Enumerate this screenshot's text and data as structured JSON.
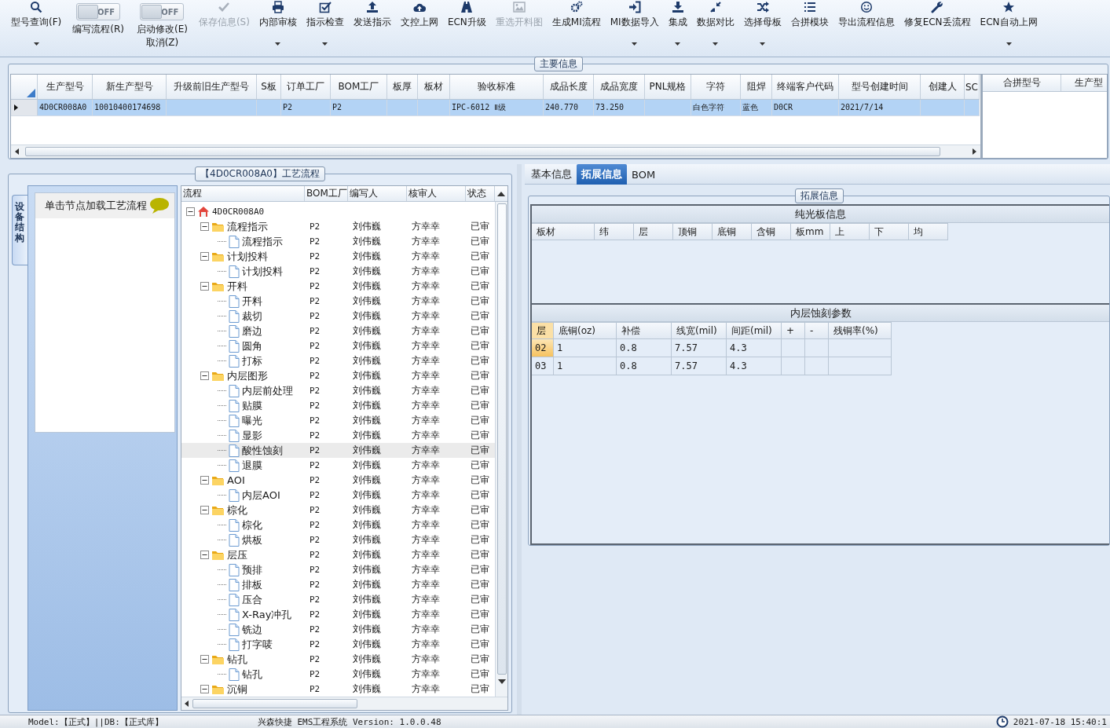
{
  "toolbar": [
    {
      "kind": "button",
      "label": "型号查询(F)",
      "disabled": false,
      "dropdown": true
    },
    {
      "kind": "toggle",
      "state": "OFF",
      "on": false,
      "lines": [
        "编写流程(R)"
      ]
    },
    {
      "kind": "toggle",
      "state": "OFF",
      "on": false,
      "lines": [
        "启动修改(E)",
        "取消(Z)"
      ]
    },
    {
      "kind": "button",
      "label": "保存信息(S)",
      "disabled": true,
      "dropdown": false
    },
    {
      "kind": "button",
      "label": "内部审核",
      "disabled": false,
      "dropdown": true
    },
    {
      "kind": "button",
      "label": "指示检查",
      "disabled": false,
      "dropdown": true
    },
    {
      "kind": "button",
      "label": "发送指示",
      "disabled": false,
      "dropdown": false
    },
    {
      "kind": "button",
      "label": "文控上网",
      "disabled": false,
      "dropdown": false
    },
    {
      "kind": "button",
      "label": "ECN升级",
      "disabled": false,
      "dropdown": false
    },
    {
      "kind": "button",
      "label": "重选开料图",
      "disabled": true,
      "dropdown": false
    },
    {
      "kind": "button",
      "label": "生成MI流程",
      "disabled": false,
      "dropdown": false
    },
    {
      "kind": "button",
      "label": "MI数据导入",
      "disabled": false,
      "dropdown": true
    },
    {
      "kind": "button",
      "label": "集成",
      "disabled": false,
      "dropdown": true
    },
    {
      "kind": "button",
      "label": "数据对比",
      "disabled": false,
      "dropdown": true
    },
    {
      "kind": "button",
      "label": "选择母板",
      "disabled": false,
      "dropdown": true
    },
    {
      "kind": "button",
      "label": "合拼模块",
      "disabled": false,
      "dropdown": false
    },
    {
      "kind": "button",
      "label": "导出流程信息",
      "disabled": false,
      "dropdown": false
    },
    {
      "kind": "button",
      "label": "修复ECN丢流程",
      "disabled": false,
      "dropdown": false
    },
    {
      "kind": "button",
      "label": "ECN自动上网",
      "disabled": false,
      "dropdown": true
    }
  ],
  "main_info": {
    "title": "主要信息",
    "columns": [
      "生产型号",
      "新生产型号",
      "升级前旧生产型号",
      "S板",
      "订单工厂",
      "BOM工厂",
      "板厚",
      "板材",
      "验收标准",
      "成品长度",
      "成品宽度",
      "PNL规格",
      "字符",
      "阻焊",
      "终端客户代码",
      "型号创建时间",
      "创建人",
      "SC"
    ],
    "rows": [
      {
        "selected": true,
        "cells": [
          "4D0CR008A0",
          "10010400174698",
          null,
          null,
          "P2",
          "P2",
          null,
          null,
          "IPC-6012 Ⅱ级",
          "240.770",
          "73.250",
          null,
          "白色字符",
          "蓝色",
          "D0CR",
          "2021/7/14",
          null,
          null
        ]
      }
    ],
    "side_table": {
      "columns": [
        "合拼型号",
        "生产型"
      ]
    }
  },
  "process_panel": {
    "title": "【4D0CR008A0】工艺流程",
    "side_tab": "设备结构",
    "hint": "单击节点加载工艺流程",
    "tree": {
      "columns": [
        "流程",
        "BOM工厂",
        "编写人",
        "核审人",
        "状态"
      ],
      "nodes": [
        {
          "kind": "root",
          "label": "4D0CR008A0",
          "expanded": true,
          "selected": false,
          "children": [
            {
              "kind": "folder",
              "label": "流程指示",
              "bom": "P2",
              "writer": "刘伟巍",
              "reviewer": "方幸幸",
              "status": "已审",
              "expanded": true,
              "selected": false,
              "children": [
                {
                  "kind": "step",
                  "label": "流程指示",
                  "bom": "P2",
                  "writer": "刘伟巍",
                  "reviewer": "方幸幸",
                  "status": "已审",
                  "selected": false
                }
              ]
            },
            {
              "kind": "folder",
              "label": "计划投料",
              "bom": "P2",
              "writer": "刘伟巍",
              "reviewer": "方幸幸",
              "status": "已审",
              "expanded": true,
              "selected": false,
              "children": [
                {
                  "kind": "step",
                  "label": "计划投料",
                  "bom": "P2",
                  "writer": "刘伟巍",
                  "reviewer": "方幸幸",
                  "status": "已审",
                  "selected": false
                }
              ]
            },
            {
              "kind": "folder",
              "label": "开料",
              "bom": "P2",
              "writer": "刘伟巍",
              "reviewer": "方幸幸",
              "status": "已审",
              "expanded": true,
              "selected": false,
              "children": [
                {
                  "kind": "step",
                  "label": "开料",
                  "bom": "P2",
                  "writer": "刘伟巍",
                  "reviewer": "方幸幸",
                  "status": "已审",
                  "selected": false
                },
                {
                  "kind": "step",
                  "label": "裁切",
                  "bom": "P2",
                  "writer": "刘伟巍",
                  "reviewer": "方幸幸",
                  "status": "已审",
                  "selected": false
                },
                {
                  "kind": "step",
                  "label": "磨边",
                  "bom": "P2",
                  "writer": "刘伟巍",
                  "reviewer": "方幸幸",
                  "status": "已审",
                  "selected": false
                },
                {
                  "kind": "step",
                  "label": "圆角",
                  "bom": "P2",
                  "writer": "刘伟巍",
                  "reviewer": "方幸幸",
                  "status": "已审",
                  "selected": false
                },
                {
                  "kind": "step",
                  "label": "打标",
                  "bom": "P2",
                  "writer": "刘伟巍",
                  "reviewer": "方幸幸",
                  "status": "已审",
                  "selected": false
                }
              ]
            },
            {
              "kind": "folder",
              "label": "内层图形",
              "bom": "P2",
              "writer": "刘伟巍",
              "reviewer": "方幸幸",
              "status": "已审",
              "expanded": true,
              "selected": false,
              "children": [
                {
                  "kind": "step",
                  "label": "内层前处理",
                  "bom": "P2",
                  "writer": "刘伟巍",
                  "reviewer": "方幸幸",
                  "status": "已审",
                  "selected": false
                },
                {
                  "kind": "step",
                  "label": "贴膜",
                  "bom": "P2",
                  "writer": "刘伟巍",
                  "reviewer": "方幸幸",
                  "status": "已审",
                  "selected": false
                },
                {
                  "kind": "step",
                  "label": "曝光",
                  "bom": "P2",
                  "writer": "刘伟巍",
                  "reviewer": "方幸幸",
                  "status": "已审",
                  "selected": false
                },
                {
                  "kind": "step",
                  "label": "显影",
                  "bom": "P2",
                  "writer": "刘伟巍",
                  "reviewer": "方幸幸",
                  "status": "已审",
                  "selected": false
                },
                {
                  "kind": "step",
                  "label": "酸性蚀刻",
                  "bom": "P2",
                  "writer": "刘伟巍",
                  "reviewer": "方幸幸",
                  "status": "已审",
                  "selected": true
                },
                {
                  "kind": "step",
                  "label": "退膜",
                  "bom": "P2",
                  "writer": "刘伟巍",
                  "reviewer": "方幸幸",
                  "status": "已审",
                  "selected": false
                }
              ]
            },
            {
              "kind": "folder",
              "label": "AOI",
              "bom": "P2",
              "writer": "刘伟巍",
              "reviewer": "方幸幸",
              "status": "已审",
              "expanded": true,
              "selected": false,
              "children": [
                {
                  "kind": "step",
                  "label": "内层AOI",
                  "bom": "P2",
                  "writer": "刘伟巍",
                  "reviewer": "方幸幸",
                  "status": "已审",
                  "selected": false
                }
              ]
            },
            {
              "kind": "folder",
              "label": "棕化",
              "bom": "P2",
              "writer": "刘伟巍",
              "reviewer": "方幸幸",
              "status": "已审",
              "expanded": true,
              "selected": false,
              "children": [
                {
                  "kind": "step",
                  "label": "棕化",
                  "bom": "P2",
                  "writer": "刘伟巍",
                  "reviewer": "方幸幸",
                  "status": "已审",
                  "selected": false
                },
                {
                  "kind": "step",
                  "label": "烘板",
                  "bom": "P2",
                  "writer": "刘伟巍",
                  "reviewer": "方幸幸",
                  "status": "已审",
                  "selected": false
                }
              ]
            },
            {
              "kind": "folder",
              "label": "层压",
              "bom": "P2",
              "writer": "刘伟巍",
              "reviewer": "方幸幸",
              "status": "已审",
              "expanded": true,
              "selected": false,
              "children": [
                {
                  "kind": "step",
                  "label": "预排",
                  "bom": "P2",
                  "writer": "刘伟巍",
                  "reviewer": "方幸幸",
                  "status": "已审",
                  "selected": false
                },
                {
                  "kind": "step",
                  "label": "排板",
                  "bom": "P2",
                  "writer": "刘伟巍",
                  "reviewer": "方幸幸",
                  "status": "已审",
                  "selected": false
                },
                {
                  "kind": "step",
                  "label": "压合",
                  "bom": "P2",
                  "writer": "刘伟巍",
                  "reviewer": "方幸幸",
                  "status": "已审",
                  "selected": false
                },
                {
                  "kind": "step",
                  "label": "X-Ray冲孔",
                  "bom": "P2",
                  "writer": "刘伟巍",
                  "reviewer": "方幸幸",
                  "status": "已审",
                  "selected": false
                },
                {
                  "kind": "step",
                  "label": "铣边",
                  "bom": "P2",
                  "writer": "刘伟巍",
                  "reviewer": "方幸幸",
                  "status": "已审",
                  "selected": false
                },
                {
                  "kind": "step",
                  "label": "打字唛",
                  "bom": "P2",
                  "writer": "刘伟巍",
                  "reviewer": "方幸幸",
                  "status": "已审",
                  "selected": false
                }
              ]
            },
            {
              "kind": "folder",
              "label": "钻孔",
              "bom": "P2",
              "writer": "刘伟巍",
              "reviewer": "方幸幸",
              "status": "已审",
              "expanded": true,
              "selected": false,
              "children": [
                {
                  "kind": "step",
                  "label": "钻孔",
                  "bom": "P2",
                  "writer": "刘伟巍",
                  "reviewer": "方幸幸",
                  "status": "已审",
                  "selected": false
                }
              ]
            },
            {
              "kind": "folder",
              "label": "沉铜",
              "bom": "P2",
              "writer": "刘伟巍",
              "reviewer": "方幸幸",
              "status": "已审",
              "expanded": true,
              "selected": false
            }
          ]
        }
      ]
    }
  },
  "detail_panel": {
    "tabs": [
      {
        "label": "基本信息",
        "selected": false
      },
      {
        "label": "拓展信息",
        "selected": true
      },
      {
        "label": "BOM",
        "selected": false
      }
    ],
    "group_title": "拓展信息",
    "bare_board": {
      "title": "纯光板信息",
      "columns": [
        "板材",
        "纬",
        "层",
        "顶铜",
        "底铜",
        "含铜",
        "板mm",
        "上",
        "下",
        "均"
      ]
    },
    "inner_etch": {
      "title": "内层蚀刻参数",
      "columns": [
        "层",
        "底铜(oz)",
        "补偿",
        "线宽(mil)",
        "间距(mil)",
        "+",
        "-",
        "残铜率(%)"
      ],
      "rows": [
        {
          "selected": true,
          "cells": [
            "02",
            "1",
            "0.8",
            "7.57",
            "4.3"
          ]
        },
        {
          "selected": false,
          "cells": [
            "03",
            "1",
            "0.8",
            "7.57",
            "4.3"
          ]
        }
      ]
    }
  },
  "status_bar": {
    "model": "Model:【正式】||DB:【正式库】",
    "product": "兴森快捷 EMS工程系统 Version: 1.0.0.48",
    "datetime": "2021-07-18 15:40:1"
  }
}
